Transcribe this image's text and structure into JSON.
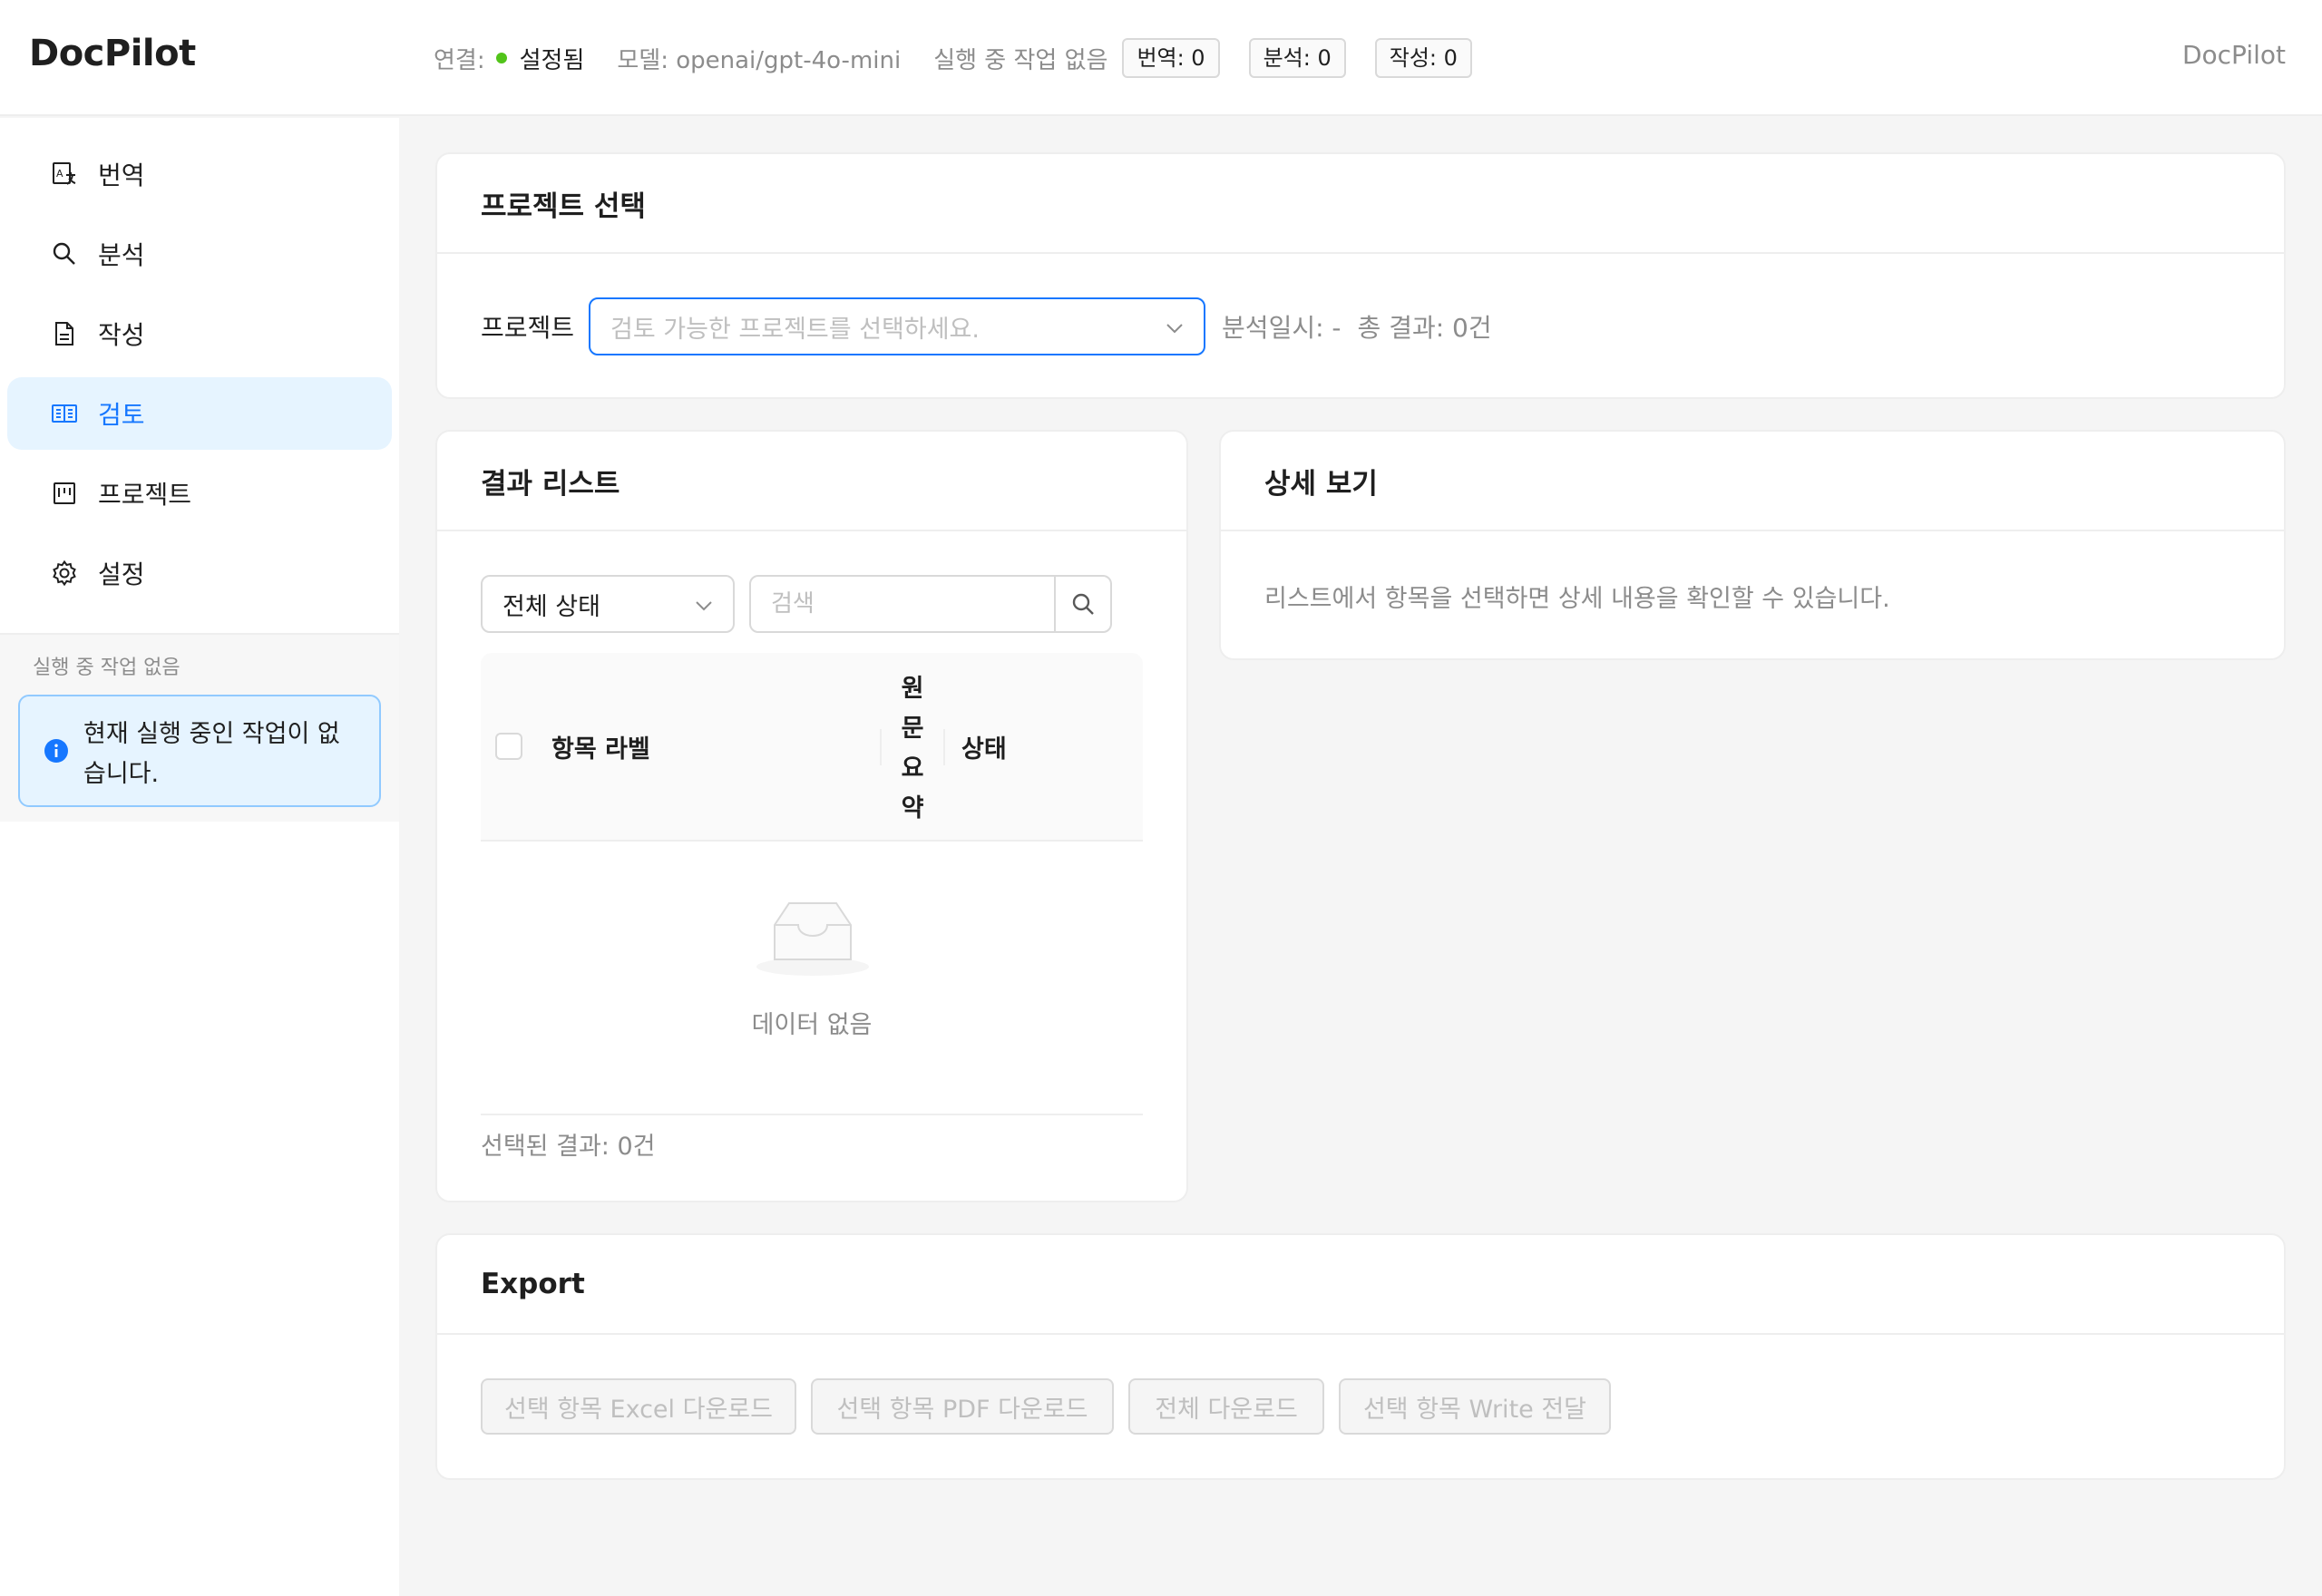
{
  "app": {
    "logo": "DocPilot",
    "header_right": "DocPilot"
  },
  "status": {
    "connection_label": "연결:",
    "connection_value": "설정됨",
    "model": "모델: openai/gpt-4o-mini",
    "running": "실행 중 작업 없음",
    "tags": [
      "번역: 0",
      "분석: 0",
      "작성: 0"
    ],
    "connection_color": "#52c41a"
  },
  "sidebar": {
    "items": [
      {
        "label": "번역",
        "icon": "translate-icon"
      },
      {
        "label": "분석",
        "icon": "search-icon"
      },
      {
        "label": "작성",
        "icon": "document-icon"
      },
      {
        "label": "검토",
        "icon": "book-icon",
        "active": true
      },
      {
        "label": "프로젝트",
        "icon": "project-icon"
      },
      {
        "label": "설정",
        "icon": "gear-icon"
      }
    ],
    "running_label": "실행 중 작업 없음",
    "alert_text": "현재 실행 중인 작업이 없습니다.",
    "accent_color": "#1677ff"
  },
  "project_card": {
    "title": "프로젝트 선택",
    "field_label": "프로젝트",
    "select_placeholder": "검토 가능한 프로젝트를 선택하세요.",
    "analysis_date": "분석일시: -",
    "total_results": "총 결과: 0건"
  },
  "results_card": {
    "title": "결과 리스트",
    "filter_value": "전체 상태",
    "search_placeholder": "검색",
    "columns": {
      "label": "항목 라벨",
      "original_summary": "원문요약",
      "status": "상태"
    },
    "empty_text": "데이터 없음",
    "selected_count": "선택된 결과: 0건"
  },
  "detail_card": {
    "title": "상세 보기",
    "hint": "리스트에서 항목을 선택하면 상세 내용을 확인할 수 있습니다."
  },
  "export_card": {
    "title": "Export",
    "buttons": [
      "선택 항목 Excel 다운로드",
      "선택 항목 PDF 다운로드",
      "전체 다운로드",
      "선택 항목 Write 전달"
    ]
  }
}
